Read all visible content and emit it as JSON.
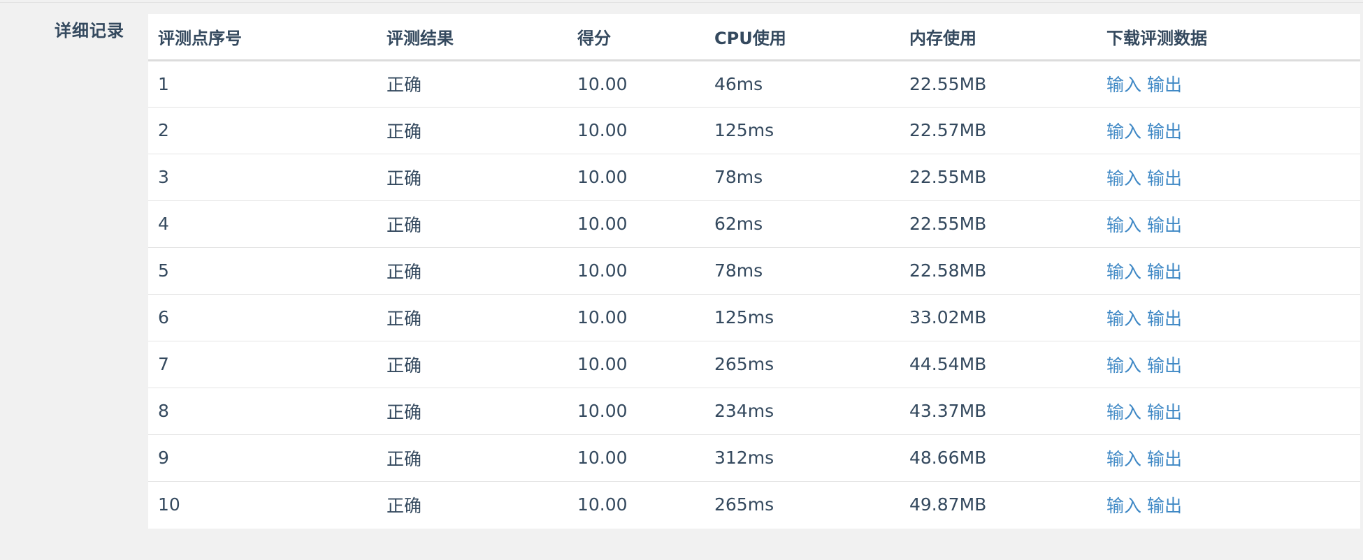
{
  "section": {
    "label": "详细记录"
  },
  "table": {
    "headers": [
      "评测点序号",
      "评测结果",
      "得分",
      "CPU使用",
      "内存使用",
      "下载评测数据"
    ],
    "rows": [
      {
        "index": "1",
        "result": "正确",
        "score": "10.00",
        "cpu": "46ms",
        "memory": "22.55MB",
        "input_link": "输入",
        "output_link": "输出"
      },
      {
        "index": "2",
        "result": "正确",
        "score": "10.00",
        "cpu": "125ms",
        "memory": "22.57MB",
        "input_link": "输入",
        "output_link": "输出"
      },
      {
        "index": "3",
        "result": "正确",
        "score": "10.00",
        "cpu": "78ms",
        "memory": "22.55MB",
        "input_link": "输入",
        "output_link": "输出"
      },
      {
        "index": "4",
        "result": "正确",
        "score": "10.00",
        "cpu": "62ms",
        "memory": "22.55MB",
        "input_link": "输入",
        "output_link": "输出"
      },
      {
        "index": "5",
        "result": "正确",
        "score": "10.00",
        "cpu": "78ms",
        "memory": "22.58MB",
        "input_link": "输入",
        "output_link": "输出"
      },
      {
        "index": "6",
        "result": "正确",
        "score": "10.00",
        "cpu": "125ms",
        "memory": "33.02MB",
        "input_link": "输入",
        "output_link": "输出"
      },
      {
        "index": "7",
        "result": "正确",
        "score": "10.00",
        "cpu": "265ms",
        "memory": "44.54MB",
        "input_link": "输入",
        "output_link": "输出"
      },
      {
        "index": "8",
        "result": "正确",
        "score": "10.00",
        "cpu": "234ms",
        "memory": "43.37MB",
        "input_link": "输入",
        "output_link": "输出"
      },
      {
        "index": "9",
        "result": "正确",
        "score": "10.00",
        "cpu": "312ms",
        "memory": "48.66MB",
        "input_link": "输入",
        "output_link": "输出"
      },
      {
        "index": "10",
        "result": "正确",
        "score": "10.00",
        "cpu": "265ms",
        "memory": "49.87MB",
        "input_link": "输入",
        "output_link": "输出"
      }
    ]
  },
  "colors": {
    "text": "#34495e",
    "link": "#3f88c5",
    "background": "#f1f1f1",
    "panel": "#ffffff"
  }
}
